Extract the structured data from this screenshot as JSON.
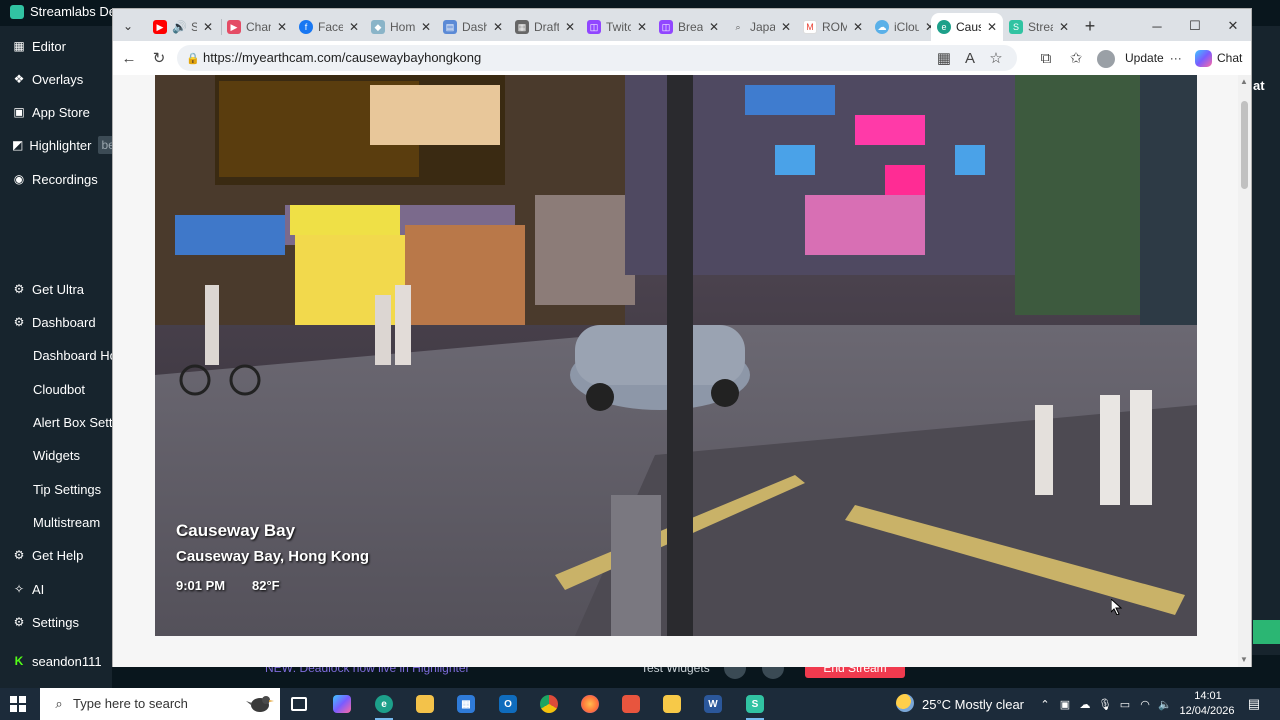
{
  "streamlabs": {
    "title": "Streamlabs De",
    "right_edge_text": "at",
    "sidebar": {
      "items": [
        {
          "label": "Editor",
          "icon": "grid-icon"
        },
        {
          "label": "Overlays",
          "icon": "overlays-icon"
        },
        {
          "label": "App Store",
          "icon": "store-icon"
        },
        {
          "label": "Highlighter",
          "icon": "highlighter-icon",
          "badge": "be"
        },
        {
          "label": "Recordings",
          "icon": "play-circle-icon"
        },
        {
          "label": "Get Ultra",
          "icon": "ultra-icon"
        },
        {
          "label": "Dashboard",
          "icon": "gear-icon"
        },
        {
          "label": "Dashboard Hor"
        },
        {
          "label": "Cloudbot"
        },
        {
          "label": "Alert Box Settin"
        },
        {
          "label": "Widgets"
        },
        {
          "label": "Tip Settings"
        },
        {
          "label": "Multistream"
        },
        {
          "label": "Get Help",
          "icon": "help-icon"
        },
        {
          "label": "AI",
          "icon": "ai-icon"
        },
        {
          "label": "Settings",
          "icon": "settings-icon"
        },
        {
          "label": "seandon111",
          "icon": "kick-icon"
        }
      ]
    },
    "news_text": "NEW: Deadlock now live in Highlighter",
    "test_widgets": "Test Widgets",
    "end_stream": "End Stream"
  },
  "browser": {
    "tabs": [
      {
        "label": "S",
        "favicon": "youtube-icon",
        "color": "#ff0000"
      },
      {
        "label": "Chann",
        "favicon": "youtube-studio-icon",
        "color": "#e44c65"
      },
      {
        "label": "Faceb",
        "favicon": "facebook-icon",
        "color": "#1877f2"
      },
      {
        "label": "Home",
        "favicon": "home-icon",
        "color": "#8ab4c8"
      },
      {
        "label": "Dashb",
        "favicon": "dashboard-icon",
        "color": "#5b8ad6"
      },
      {
        "label": "Drafts",
        "favicon": "drafts-icon",
        "color": "#666666"
      },
      {
        "label": "Twitch",
        "favicon": "twitch-icon",
        "color": "#9146ff"
      },
      {
        "label": "Break",
        "favicon": "twitch-icon",
        "color": "#9146ff"
      },
      {
        "label": "Japan",
        "favicon": "search-icon",
        "color": "#777777"
      },
      {
        "label": "ROM",
        "favicon": "gmail-icon",
        "color": "#ea4335"
      },
      {
        "label": "iClou",
        "favicon": "icloud-icon",
        "color": "#5ab0e8"
      },
      {
        "label": "Cause",
        "favicon": "edge-icon",
        "color": "#1da08a",
        "active": true
      },
      {
        "label": "Strea",
        "favicon": "streamlabs-icon",
        "color": "#31c3a2"
      }
    ],
    "url": "https://myearthcam.com/causewaybayhongkong",
    "update_label": "Update",
    "chat_label": "Chat",
    "camera": {
      "title": "Causeway Bay",
      "location": "Causeway Bay, Hong Kong",
      "time": "9:01 PM",
      "temperature": "82°F"
    }
  },
  "taskbar": {
    "search_placeholder": "Type here to search",
    "apps": [
      {
        "name": "task-view-icon",
        "color": "#1c2b3a"
      },
      {
        "name": "copilot-app-icon",
        "color": "#6c63ff"
      },
      {
        "name": "edge-app-icon",
        "color": "#1da08a",
        "active": true
      },
      {
        "name": "file-explorer-icon",
        "color": "#f3c24a"
      },
      {
        "name": "microsoft-store-icon",
        "color": "#2f7bd8"
      },
      {
        "name": "outlook-icon",
        "color": "#0f6cbd"
      },
      {
        "name": "chrome-icon",
        "color": "#dd4b39"
      },
      {
        "name": "firefox-icon",
        "color": "#ff7139"
      },
      {
        "name": "app-icon",
        "color": "#e8553e"
      },
      {
        "name": "sticky-notes-icon",
        "color": "#f7c948"
      },
      {
        "name": "word-icon",
        "color": "#2b579a"
      },
      {
        "name": "streamlabs-app-icon",
        "color": "#31c3a2",
        "active": true
      }
    ],
    "weather": "25°C  Mostly clear",
    "time": "14:01",
    "date": "12/04/2026"
  }
}
